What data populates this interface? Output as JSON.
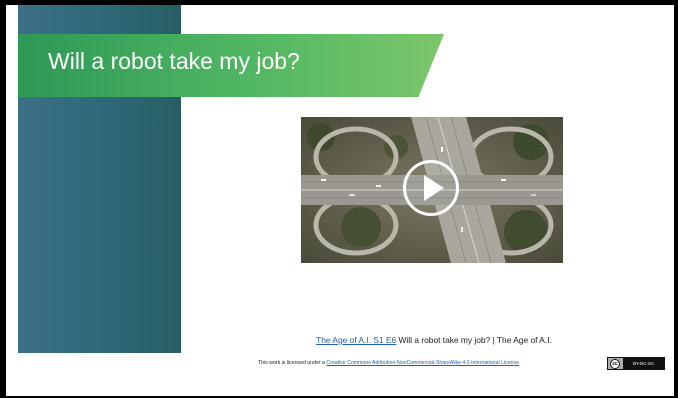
{
  "slide": {
    "title": "Will a robot take my job?",
    "video": {
      "play_icon": "play-icon"
    },
    "caption": {
      "link_text": "The Age of A.I.  S1 E6",
      "rest": " Will a robot take my job? | The Age of A.I."
    },
    "license": {
      "prefix": "This work is licensed under a ",
      "link_text": "Creative Commons Attribution-NonCommercial-ShareAlike 4.0 International License",
      "badge_text": "BY-NC-SA",
      "badge_logo": "cc"
    }
  }
}
